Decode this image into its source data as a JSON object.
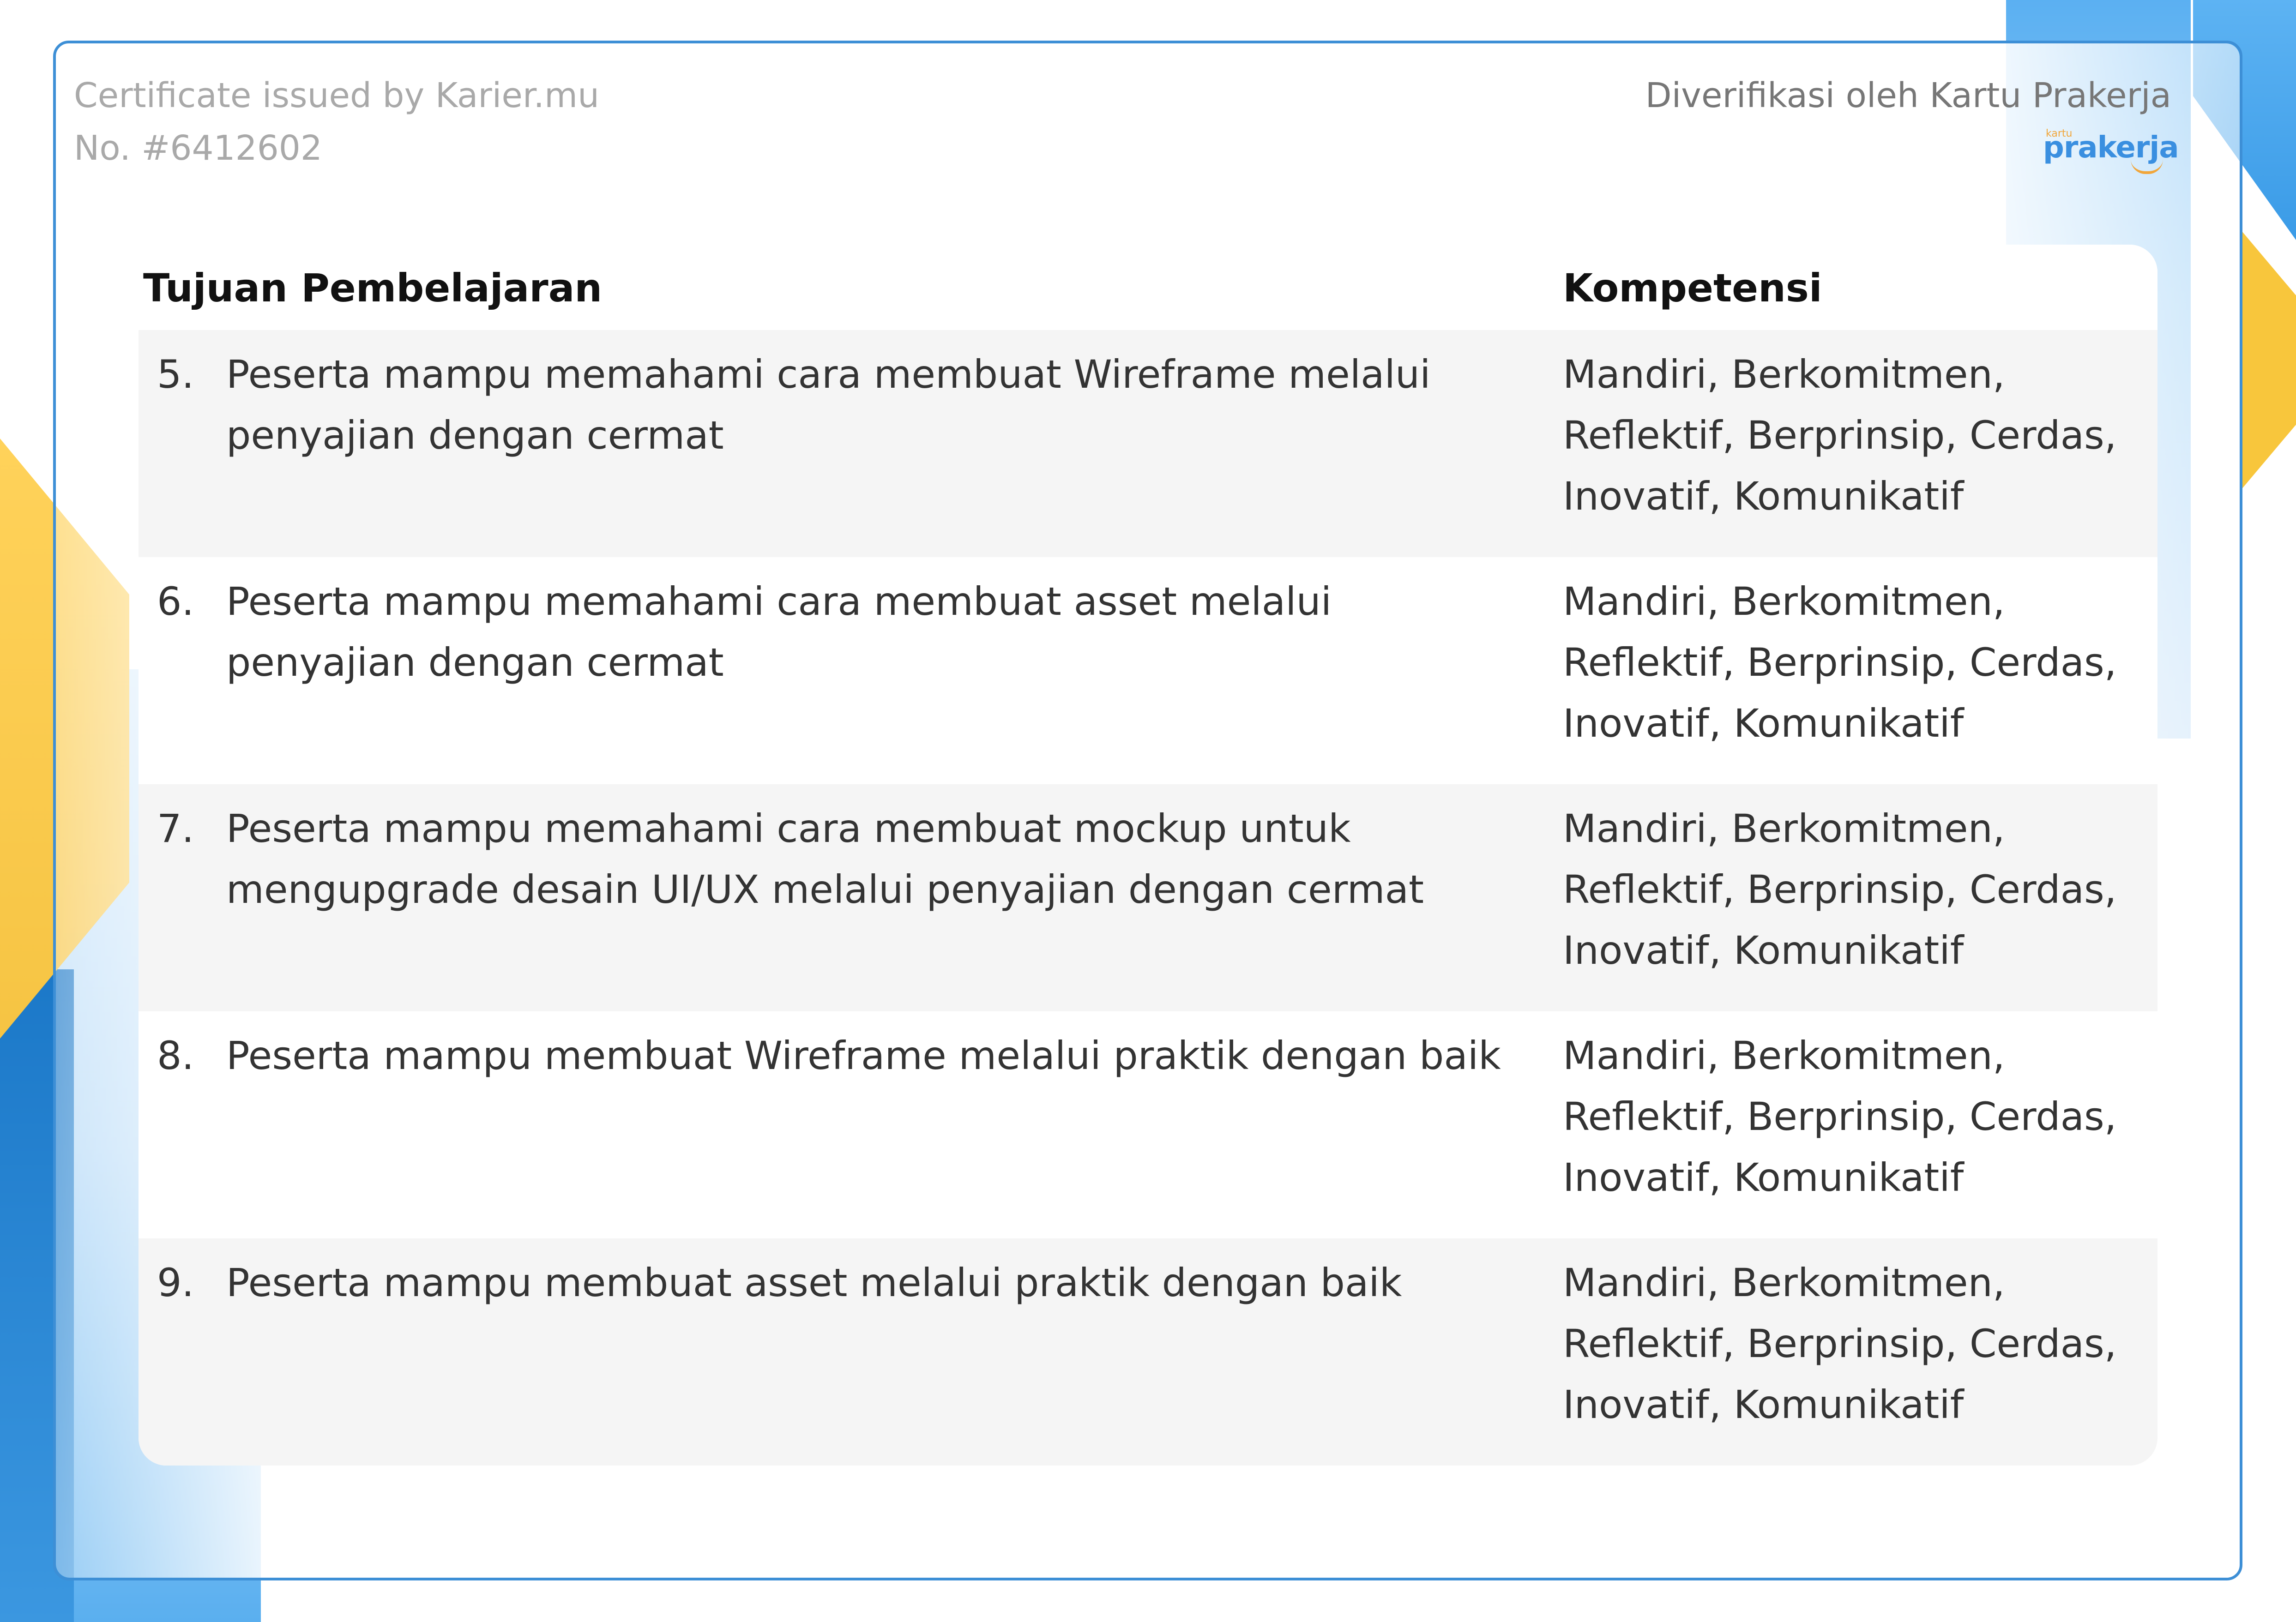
{
  "header": {
    "issuer": "Certificate issued by Karier.mu",
    "number": "No. #6412602",
    "verified_by": "Diverifikasi oleh Kartu Prakerja",
    "logo_small": "kartu",
    "logo_main": "prakerja"
  },
  "table": {
    "col_goal": "Tujuan Pembelajaran",
    "col_comp": "Kompetensi",
    "rows": [
      {
        "num": "5.",
        "goal": "Peserta mampu memahami cara membuat Wireframe melalui penyajian dengan cermat",
        "comp": "Mandiri, Berkomitmen, Reflektif, Berprinsip, Cerdas, Inovatif, Komunikatif"
      },
      {
        "num": "6.",
        "goal": "Peserta mampu memahami cara membuat asset melalui penyajian dengan cermat",
        "comp": "Mandiri, Berkomitmen, Reflektif, Berprinsip, Cerdas, Inovatif, Komunikatif"
      },
      {
        "num": "7.",
        "goal": "Peserta mampu memahami cara membuat mockup untuk mengupgrade desain UI/UX melalui penyajian dengan cermat",
        "comp": "Mandiri, Berkomitmen, Reflektif, Berprinsip, Cerdas, Inovatif, Komunikatif"
      },
      {
        "num": "8.",
        "goal": "Peserta mampu membuat Wireframe melalui praktik dengan baik",
        "comp": "Mandiri, Berkomitmen, Reflektif, Berprinsip, Cerdas, Inovatif, Komunikatif"
      },
      {
        "num": "9.",
        "goal": "Peserta mampu membuat asset melalui praktik dengan baik",
        "comp": "Mandiri, Berkomitmen, Reflektif, Berprinsip, Cerdas, Inovatif, Komunikatif"
      }
    ]
  },
  "colors": {
    "frame_border": "#3d8fd6",
    "accent_yellow": "#f8c63c",
    "accent_blue": "#3a8fe0",
    "row_shade": "#f5f5f5"
  }
}
